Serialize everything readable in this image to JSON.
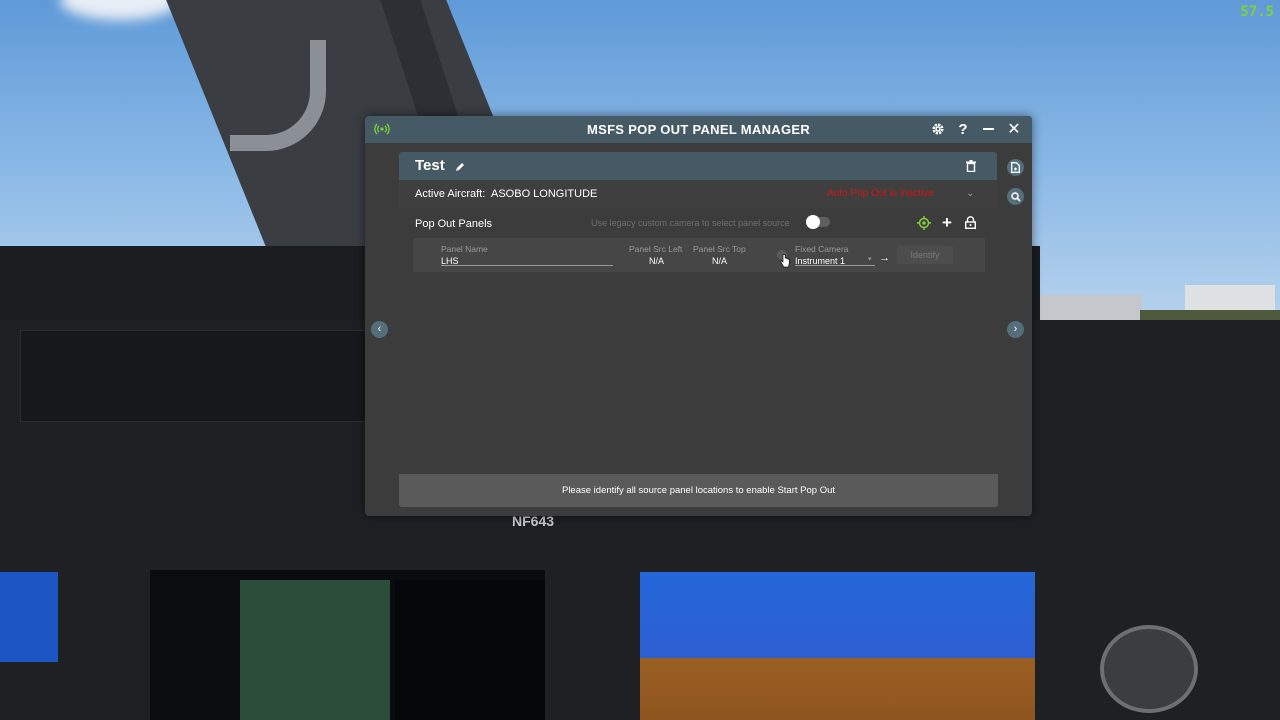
{
  "sim": {
    "fps": "57.5",
    "tail_number": "NF643"
  },
  "window": {
    "title": "MSFS POP OUT PANEL MANAGER",
    "icons": [
      "broadcast-icon",
      "gear-icon",
      "help-icon",
      "minimize-icon",
      "close-icon"
    ]
  },
  "profile": {
    "name": "Test",
    "edit_icon": "pencil-icon",
    "delete_icon": "trash-icon"
  },
  "aircraft": {
    "label": "Active Aircraft:",
    "value": "ASOBO LONGITUDE",
    "auto_pop_out": "Auto Pop Out is inactive"
  },
  "pop_out": {
    "label": "Pop Out Panels",
    "legacy_camera_label": "Use legacy custom camera to select panel source",
    "legacy_camera_on": false
  },
  "panels": [
    {
      "name_label": "Panel Name",
      "name_value": "LHS",
      "src_left_label": "Panel Src Left",
      "src_left_value": "N/A",
      "src_top_label": "Panel Src Top",
      "src_top_value": "N/A",
      "camera_label": "Fixed Camera",
      "camera_value": "Instrument 1",
      "identify_label": "Identify"
    }
  ],
  "status": {
    "message": "Please identify all source panel locations to enable Start Pop Out"
  },
  "colors": {
    "accent": "#455a64",
    "warning": "#d21414",
    "target": "#7fd13b"
  }
}
